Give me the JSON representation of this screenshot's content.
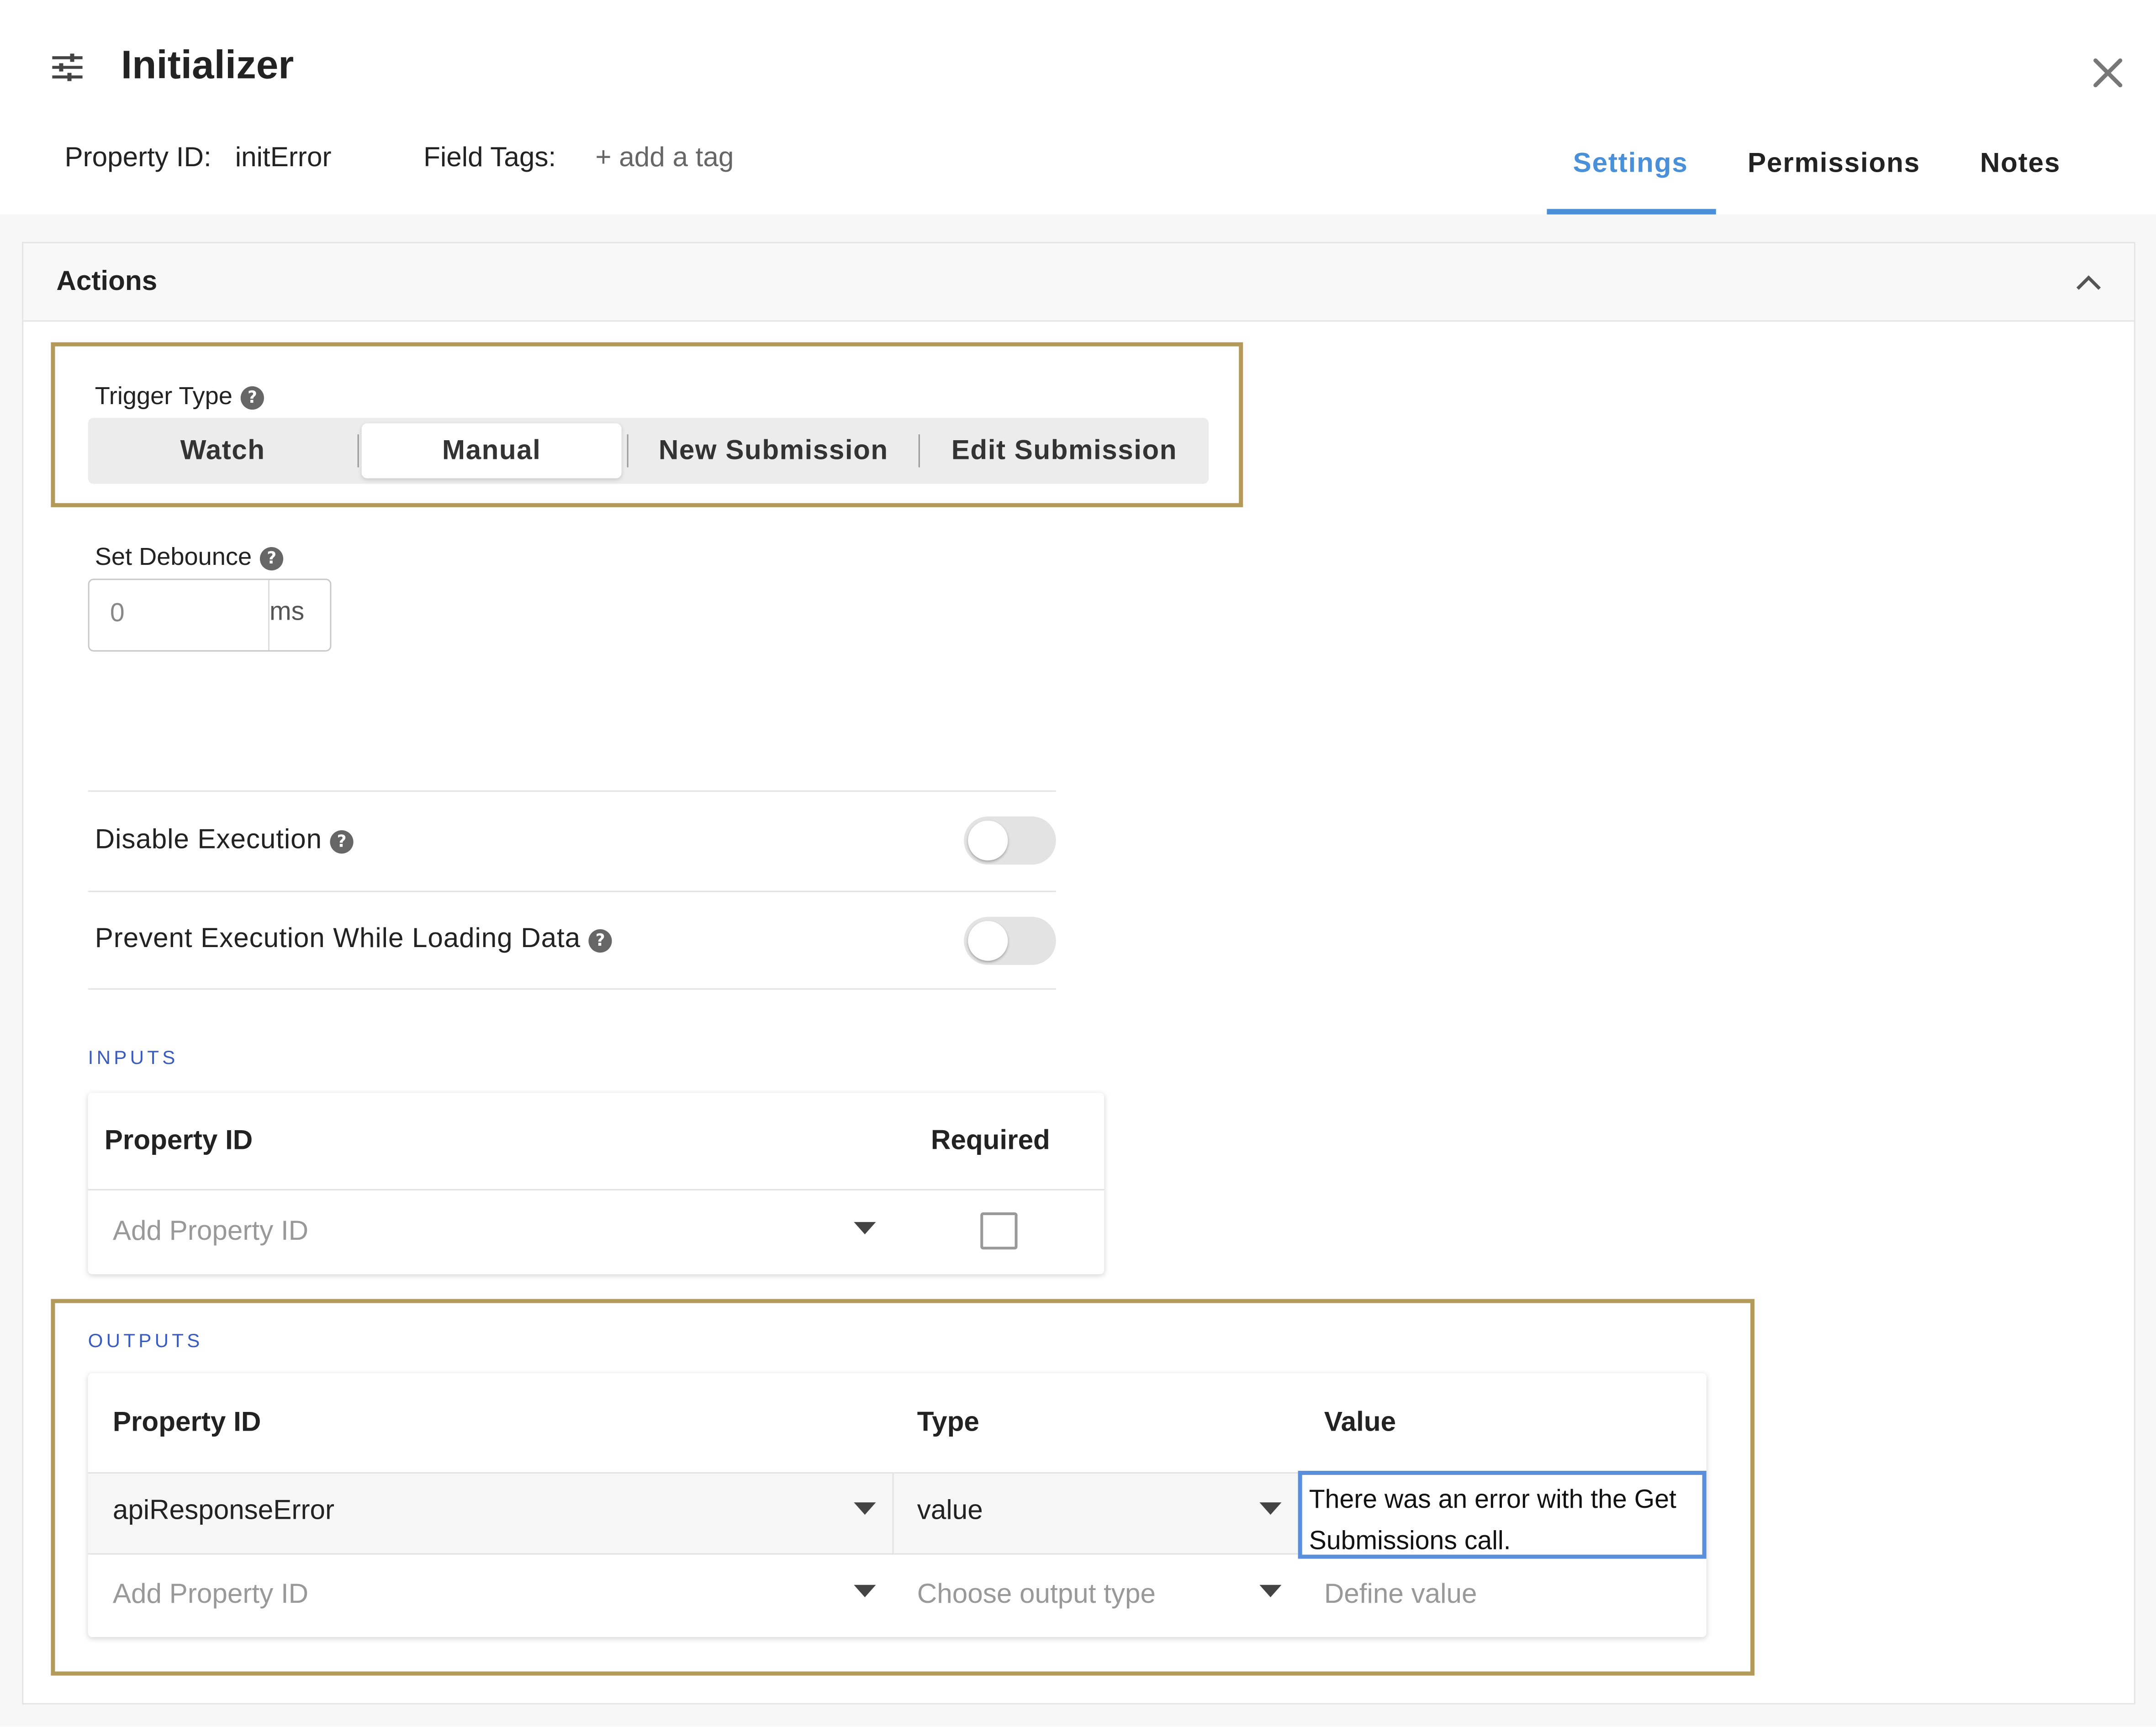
{
  "header": {
    "title": "Initializer",
    "property_id_label": "Property ID:",
    "property_id_value": "initError",
    "field_tags_label": "Field Tags:",
    "add_tag": "+ add a tag",
    "tabs": [
      {
        "label": "Settings",
        "active": true
      },
      {
        "label": "Permissions",
        "active": false
      },
      {
        "label": "Notes",
        "active": false
      }
    ]
  },
  "actions": {
    "title": "Actions",
    "trigger_type": {
      "label": "Trigger Type",
      "options": [
        "Watch",
        "Manual",
        "New Submission",
        "Edit Submission"
      ],
      "selected": "Manual"
    },
    "debounce": {
      "label": "Set Debounce",
      "value": "0",
      "unit": "ms"
    },
    "toggles": [
      {
        "label": "Disable Execution",
        "on": false
      },
      {
        "label": "Prevent Execution While Loading Data",
        "on": false
      }
    ],
    "inputs": {
      "section_label": "INPUTS",
      "columns": [
        "Property ID",
        "Required"
      ],
      "rows": [
        {
          "property_id_placeholder": "Add Property ID",
          "required": false
        }
      ]
    },
    "outputs": {
      "section_label": "OUTPUTS",
      "columns": [
        "Property ID",
        "Type",
        "Value"
      ],
      "rows": [
        {
          "property_id": "apiResponseError",
          "type": "value",
          "value": "There was an error with the Get Submissions call."
        }
      ],
      "new_row": {
        "property_id_placeholder": "Add Property ID",
        "type_placeholder": "Choose output type",
        "value_placeholder": "Define value"
      }
    }
  },
  "colors": {
    "accent": "#4a90d9",
    "highlight_border": "#b49a5a",
    "section_label": "#3a5bbf",
    "active_input_border": "#5a8fdc"
  },
  "icons": [
    "sliders-icon",
    "close-icon",
    "chevron-up-icon",
    "help-icon",
    "caret-down-icon"
  ]
}
